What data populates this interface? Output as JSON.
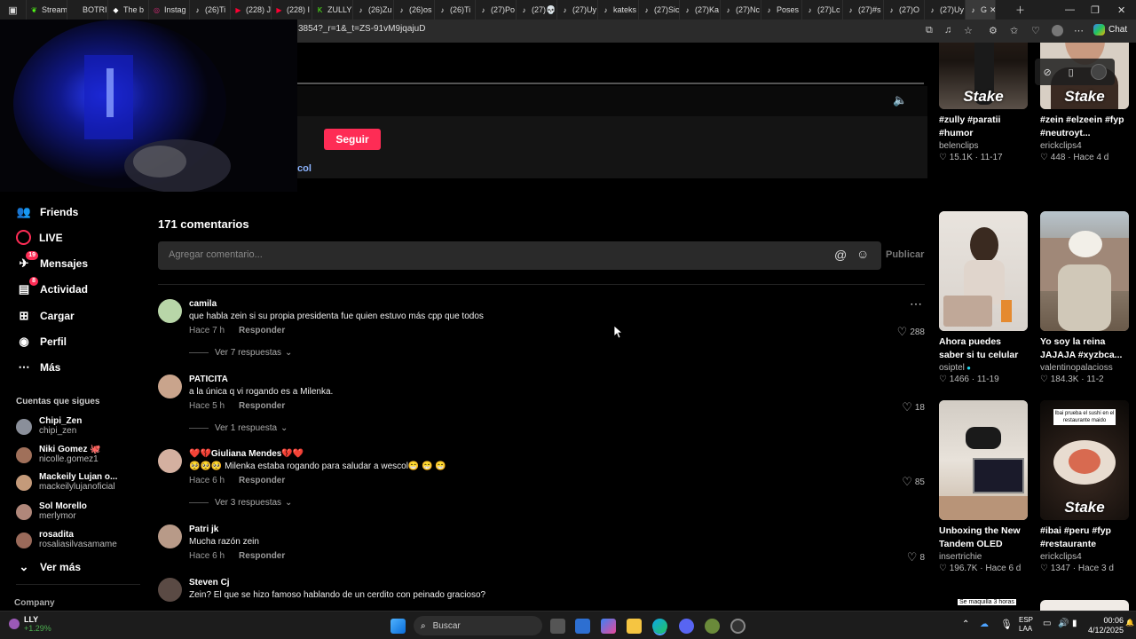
{
  "browser": {
    "tabs": [
      {
        "label": "Stream",
        "icon": "leaf-icon",
        "color": "#53fc18"
      },
      {
        "label": "BOTRI",
        "icon": "blank-icon",
        "color": "#444"
      },
      {
        "label": "The b",
        "icon": "diamond-icon",
        "color": "#fff"
      },
      {
        "label": "Instag",
        "icon": "instagram-icon",
        "color": "#d62976"
      },
      {
        "label": "(26)Ti",
        "icon": "tiktok-icon",
        "color": "#fff"
      },
      {
        "label": "(228) J",
        "icon": "youtube-icon",
        "color": "#ff0033"
      },
      {
        "label": "(228) I",
        "icon": "youtube-icon",
        "color": "#ff0033"
      },
      {
        "label": "ZULLY",
        "icon": "kick-icon",
        "color": "#53fc18"
      },
      {
        "label": "(26)Zu",
        "icon": "tiktok-icon",
        "color": "#fff"
      },
      {
        "label": "(26)os",
        "icon": "tiktok-icon",
        "color": "#fff"
      },
      {
        "label": "(26)Ti",
        "icon": "tiktok-icon",
        "color": "#fff"
      },
      {
        "label": "(27)Po",
        "icon": "tiktok-icon",
        "color": "#fff"
      },
      {
        "label": "(27)💀",
        "icon": "tiktok-icon",
        "color": "#fff"
      },
      {
        "label": "(27)Uy",
        "icon": "tiktok-icon",
        "color": "#fff"
      },
      {
        "label": "kateks",
        "icon": "tiktok-icon",
        "color": "#fff"
      },
      {
        "label": "(27)Sic",
        "icon": "tiktok-icon",
        "color": "#fff"
      },
      {
        "label": "(27)Ka",
        "icon": "tiktok-icon",
        "color": "#fff"
      },
      {
        "label": "(27)Nc",
        "icon": "tiktok-icon",
        "color": "#fff"
      },
      {
        "label": "Poses",
        "icon": "tiktok-icon",
        "color": "#fff"
      },
      {
        "label": "(27)Lc",
        "icon": "tiktok-icon",
        "color": "#fff"
      },
      {
        "label": "(27)#s",
        "icon": "tiktok-icon",
        "color": "#fff"
      },
      {
        "label": "(27)O",
        "icon": "tiktok-icon",
        "color": "#fff"
      },
      {
        "label": "(27)Uy",
        "icon": "tiktok-icon",
        "color": "#fff"
      },
      {
        "label": "G",
        "icon": "tiktok-icon",
        "color": "#fff",
        "active": true
      }
    ],
    "url": "3854?_r=1&_t=ZS-91vM9jqajuD",
    "copilot_label": "Chat"
  },
  "video": {
    "follow_label": "Seguir",
    "caption_fragment": "col"
  },
  "sidebar": {
    "nav": [
      {
        "label": "Friends",
        "icon": "friends-icon"
      },
      {
        "label": "LIVE",
        "icon": "live-icon"
      },
      {
        "label": "Mensajes",
        "icon": "messages-icon",
        "badge": "19"
      },
      {
        "label": "Actividad",
        "icon": "activity-icon",
        "badge": "8"
      },
      {
        "label": "Cargar",
        "icon": "upload-icon"
      },
      {
        "label": "Perfil",
        "icon": "profile-icon"
      },
      {
        "label": "Más",
        "icon": "more-icon"
      }
    ],
    "following_title": "Cuentas que sigues",
    "following": [
      {
        "name": "Chipi_Zen",
        "handle": "chipi_zen",
        "color": "#8a8f9a"
      },
      {
        "name": "Niki Gomez 🐙",
        "handle": "nicolle.gomez1",
        "color": "#a0705a"
      },
      {
        "name": "Mackeily Lujan o...",
        "handle": "mackeilylujanoficial",
        "color": "#c49a7a"
      },
      {
        "name": "Sol Morello",
        "handle": "merlymor",
        "color": "#b0877a"
      },
      {
        "name": "rosadita",
        "handle": "rosaliasilvasamame",
        "color": "#9a6a5a"
      }
    ],
    "see_more": "Ver más",
    "company": "Company"
  },
  "comments": {
    "count_label": "171 comentarios",
    "placeholder": "Agregar comentario...",
    "publish": "Publicar",
    "reply_label": "Responder",
    "items": [
      {
        "user": "camila",
        "text": "que habla zein si su propia presidenta fue quien estuvo más cpp que todos",
        "time": "Hace 7 h",
        "likes": "288",
        "replies": "Ver 7 respuestas",
        "avatar": "#b8d6a8"
      },
      {
        "user": "PATICITA",
        "text": "a la única q vi rogando es a Milenka.",
        "time": "Hace 5 h",
        "likes": "18",
        "replies": "Ver 1 respuesta",
        "avatar": "#c9a48c"
      },
      {
        "user": "❤️💔Giuliana Mendes💔❤️",
        "text": "🥺🥺🥺 Milenka estaba rogando para saludar a wescol😁 😁 😁",
        "time": "Hace 6 h",
        "likes": "85",
        "replies": "Ver 3 respuestas",
        "avatar": "#d4b0a0"
      },
      {
        "user": "Patri jk",
        "text": "Mucha razón zein",
        "time": "Hace 6 h",
        "likes": "8",
        "replies": "",
        "avatar": "#b89a88"
      },
      {
        "user": "Steven Cj",
        "text": "Zein? El que se hizo famoso hablando de un cerdito con peinado gracioso?",
        "time": "",
        "likes": "",
        "replies": "",
        "avatar": "#5a4a44"
      }
    ]
  },
  "recommendations": [
    {
      "title": "#zully #paratii #humor",
      "author": "belenclips",
      "likes": "15.1K",
      "date": "11-17",
      "overlay": "Stake",
      "bg": "#5a4a3c"
    },
    {
      "title": "#zein #elzeein #fyp #neutroyt...",
      "author": "erickclips4",
      "likes": "448",
      "date": "Hace 4 d",
      "overlay": "Stake",
      "bg": "#8a6a58"
    },
    {
      "title": "Ahora puedes saber si tu celular no está...",
      "author": "osiptel",
      "likes": "1466",
      "date": "11-19",
      "overlay": "",
      "bg": "#e8e2dc",
      "verified": true
    },
    {
      "title": "Yo soy la reina JAJAJA #xyzbca...",
      "author": "valentinopalacioss",
      "likes": "184.3K",
      "date": "11-2",
      "overlay": "",
      "bg": "#9a8a7a"
    },
    {
      "title": "Unboxing the New Tandem OLED ROG...",
      "author": "insertrichie",
      "likes": "196.7K",
      "date": "Hace 6 d",
      "overlay": "",
      "bg": "#dcd6cc"
    },
    {
      "title": "#ibai #peru #fyp #restaurante #maido",
      "author": "erickclips4",
      "likes": "1347",
      "date": "Hace 3 d",
      "overlay": "Stake",
      "bg": "#2a1a14",
      "topcap": "Ibai prueba el sushi en el restaurante maido"
    }
  ],
  "partial_caption": "Se maquilla 3 horas",
  "taskbar": {
    "stock_name": "LLY",
    "stock_change": "+1.29%",
    "search_placeholder": "Buscar",
    "lang1": "ESP",
    "lang2": "LAA",
    "time": "00:06",
    "date": "4/12/2025"
  }
}
